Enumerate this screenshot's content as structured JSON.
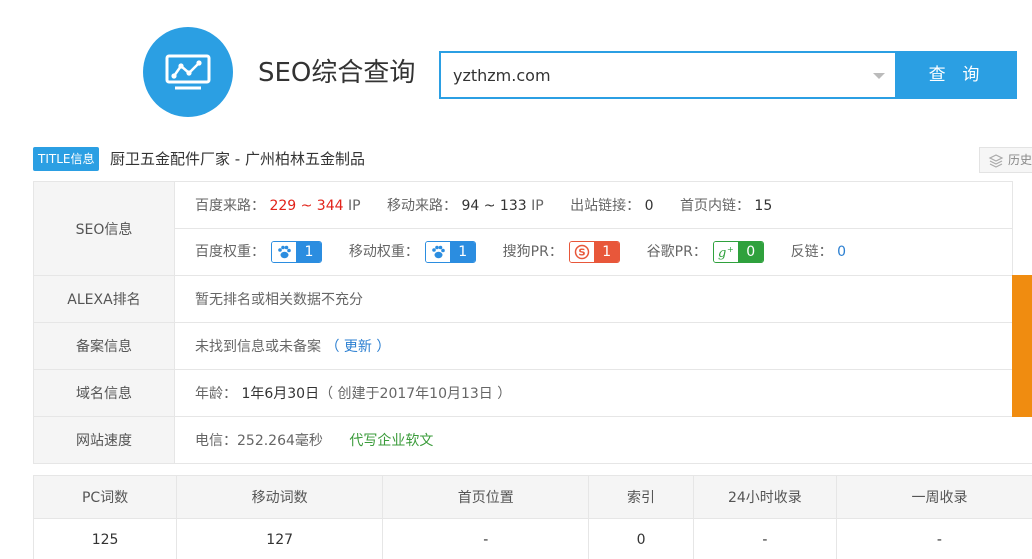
{
  "site_title": "SEO综合查询",
  "search": {
    "value": "yzthzm.com",
    "button_label": "查 询"
  },
  "title_info": {
    "tag": "TITLE信息",
    "text": "厨卫五金配件厂家 - 广州柏林五金制品",
    "history_label": "历史"
  },
  "seo_info": {
    "label": "SEO信息",
    "baidu_source_label": "百度来路：",
    "baidu_source_range": "229 ~ 344",
    "ip_unit": "IP",
    "mobile_source_label": "移动来路：",
    "mobile_source_range": "94 ~ 133",
    "outbound_label": "出站链接：",
    "outbound_value": "0",
    "inner_label": "首页内链：",
    "inner_value": "15",
    "baidu_weight_label": "百度权重：",
    "baidu_weight": "1",
    "mobile_weight_label": "移动权重：",
    "mobile_weight": "1",
    "sogou_label": "搜狗PR：",
    "sogou_value": "1",
    "google_label": "谷歌PR：",
    "google_value": "0",
    "backlink_label": "反链：",
    "backlink_value": "0"
  },
  "alexa": {
    "label": "ALEXA排名",
    "value": "暂无排名或相关数据不充分"
  },
  "icp": {
    "label": "备案信息",
    "value": "未找到信息或未备案",
    "update_link": "（ 更新 ）"
  },
  "domain": {
    "label": "域名信息",
    "age_label": "年龄：",
    "age_value": "1年6月30日",
    "created": "（ 创建于2017年10月13日 ）"
  },
  "speed": {
    "label": "网站速度",
    "value": "电信：252.264毫秒",
    "ad_link": "代写企业软文"
  },
  "stats": {
    "headers": [
      "PC词数",
      "移动词数",
      "首页位置",
      "索引",
      "24小时收录",
      "一周收录"
    ],
    "values": [
      "125",
      "127",
      "-",
      "0",
      "-",
      "-"
    ]
  },
  "colors": {
    "accent": "#2b9fe3",
    "red": "#e2231a",
    "sogou": "#e8573a",
    "google": "#2fa13d",
    "link": "#2b7fd1",
    "ad": "#3a9b3a"
  }
}
